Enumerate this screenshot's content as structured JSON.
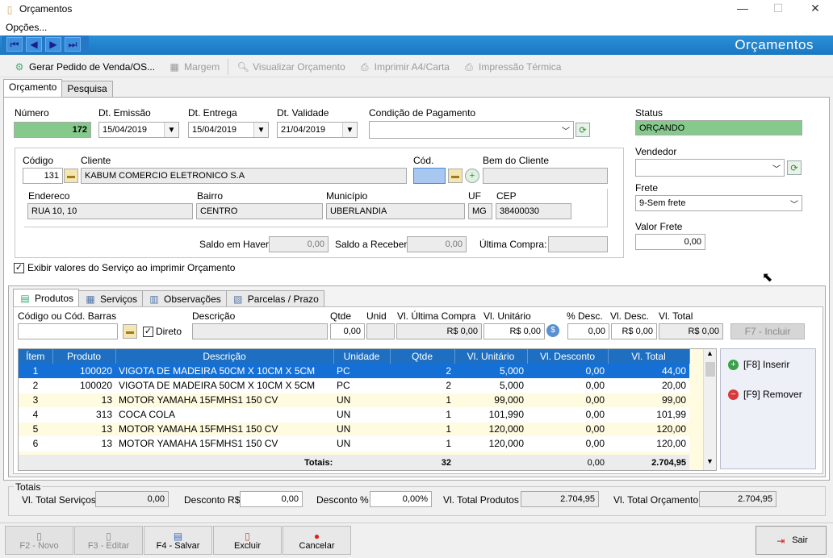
{
  "window": {
    "title": "Orçamentos",
    "minimize": "—",
    "maximize": "☐",
    "close": "✕"
  },
  "menu": {
    "options": "Opções..."
  },
  "header": {
    "title": "Orçamentos"
  },
  "toolbar": {
    "gerar": "Gerar Pedido de Venda/OS...",
    "margem": "Margem",
    "visualizar": "Visualizar Orçamento",
    "imprimir": "Imprimir A4/Carta",
    "termica": "Impressão Térmica"
  },
  "tabs": {
    "orcamento": "Orçamento",
    "pesquisa": "Pesquisa"
  },
  "form": {
    "numero_label": "Número",
    "numero": "172",
    "emissao_label": "Dt. Emissão",
    "emissao": "15/04/2019",
    "entrega_label": "Dt. Entrega",
    "entrega": "15/04/2019",
    "validade_label": "Dt. Validade",
    "validade": "21/04/2019",
    "condicao_label": "Condição de Pagamento",
    "condicao": "",
    "status_label": "Status",
    "status": "ORÇANDO",
    "vendedor_label": "Vendedor",
    "vendedor": "",
    "frete_label": "Frete",
    "frete": "9-Sem frete",
    "valor_frete_label": "Valor Frete",
    "valor_frete": "0,00"
  },
  "cliente": {
    "codigo_label": "Código",
    "codigo": "131",
    "cliente_label": "Cliente",
    "cliente": "KABUM COMERCIO ELETRONICO S.A",
    "cod_label": "Cód.",
    "cod": "",
    "bem_label": "Bem do Cliente",
    "bem": "",
    "endereco_label": "Endereco",
    "endereco": "RUA 10, 10",
    "bairro_label": "Bairro",
    "bairro": "CENTRO",
    "municipio_label": "Município",
    "municipio": "UBERLANDIA",
    "uf_label": "UF",
    "uf": "MG",
    "cep_label": "CEP",
    "cep": "38400030",
    "saldo_haver_label": "Saldo em Haver:",
    "saldo_haver": "0,00",
    "saldo_receber_label": "Saldo a Receber:",
    "saldo_receber": "0,00",
    "ultima_compra_label": "Última Compra:",
    "ultima_compra": ""
  },
  "exibir_servico": "Exibir valores do Serviço ao imprimir Orçamento",
  "inner_tabs": {
    "produtos": "Produtos",
    "servicos": "Serviços",
    "observacoes": "Observações",
    "parcelas": "Parcelas / Prazo"
  },
  "entry": {
    "codigo_label": "Código ou Cód. Barras",
    "codigo": "",
    "direto": "Direto",
    "descricao_label": "Descrição",
    "descricao": "",
    "qtde_label": "Qtde",
    "qtde": "0,00",
    "unid_label": "Unid",
    "unid": "",
    "ultima_label": "Vl. Última Compra",
    "ultima": "R$ 0,00",
    "unitario_label": "Vl. Unitário",
    "unitario": "R$ 0,00",
    "pdesc_label": "% Desc.",
    "pdesc": "0,00",
    "vdesc_label": "Vl. Desc.",
    "vdesc": "R$ 0,00",
    "total_label": "Vl. Total",
    "total": "R$ 0,00",
    "incluir": "F7 - Incluir"
  },
  "grid": {
    "headers": [
      "Ítem",
      "Produto",
      "Descrição",
      "Unidade",
      "Qtde",
      "Vl. Unitário",
      "Vl. Desconto",
      "Vl. Total"
    ],
    "rows": [
      [
        "1",
        "100020",
        "VIGOTA DE MADEIRA 50CM X 10CM X 5CM",
        "PC",
        "2",
        "5,000",
        "0,00",
        "44,00"
      ],
      [
        "2",
        "100020",
        "VIGOTA DE MADEIRA 50CM X 10CM X 5CM",
        "PC",
        "2",
        "5,000",
        "0,00",
        "20,00"
      ],
      [
        "3",
        "13",
        "MOTOR YAMAHA 15FMHS1 150 CV",
        "UN",
        "1",
        "99,000",
        "0,00",
        "99,00"
      ],
      [
        "4",
        "313",
        "COCA COLA",
        "UN",
        "1",
        "101,990",
        "0,00",
        "101,99"
      ],
      [
        "5",
        "13",
        "MOTOR YAMAHA 15FMHS1 150 CV",
        "UN",
        "1",
        "120,000",
        "0,00",
        "120,00"
      ],
      [
        "6",
        "13",
        "MOTOR YAMAHA 15FMHS1 150 CV",
        "UN",
        "1",
        "120,000",
        "0,00",
        "120,00"
      ]
    ],
    "totais_label": "Totais:",
    "totais_qtde": "32",
    "totais_desc": "0,00",
    "totais_total": "2.704,95"
  },
  "side": {
    "inserir": "[F8] Inserir",
    "remover": "[F9] Remover"
  },
  "totais": {
    "title": "Totais",
    "servicos_label": "Vl. Total Serviços",
    "servicos": "0,00",
    "desconto_label": "Desconto R$",
    "desconto": "0,00",
    "desconto_pct_label": "Desconto %",
    "desconto_pct": "0,00%",
    "produtos_label": "Vl. Total Produtos",
    "produtos": "2.704,95",
    "orcamento_label": "Vl. Total Orçamento",
    "orcamento": "2.704,95"
  },
  "footer": {
    "novo": "F2 - Novo",
    "editar": "F3 - Editar",
    "salvar": "F4 - Salvar",
    "excluir": "Excluir",
    "cancelar": "Cancelar",
    "sair": "Sair"
  }
}
